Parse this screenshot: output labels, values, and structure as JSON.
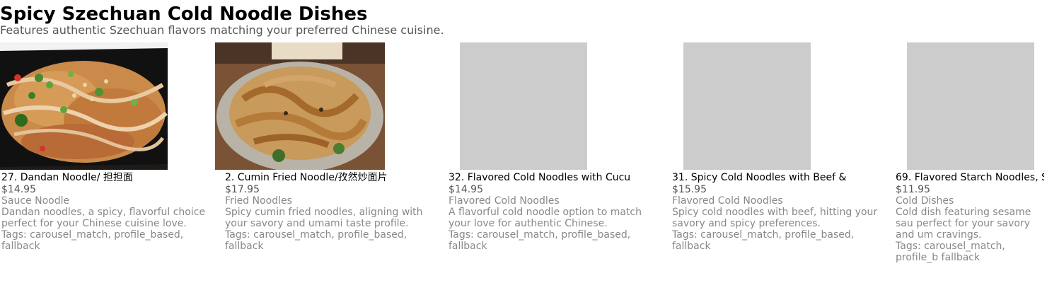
{
  "header": {
    "title": "Spicy Szechuan Cold Noodle Dishes",
    "subtitle": "Features authentic Szechuan flavors matching your preferred Chinese cuisine."
  },
  "tags_label": "Tags:",
  "items": [
    {
      "name": "27. Dandan Noodle/ 担担面",
      "price": "$14.95",
      "category": "Sauce Noodle",
      "description": "Dandan noodles, a spicy, flavorful choice perfect for your Chinese cuisine love.",
      "tags": "carousel_match, profile_based, fallback",
      "image": "photo"
    },
    {
      "name": "2. Cumin Fried Noodle/孜然炒面片",
      "price": "$17.95",
      "category": "Fried Noodles",
      "description": "Spicy cumin fried noodles, aligning with your savory and umami taste profile.",
      "tags": "carousel_match, profile_based, fallback",
      "image": "photo"
    },
    {
      "name": "32. Flavored Cold Noodles with Cucu",
      "price": "$14.95",
      "category": "Flavored Cold Noodles",
      "description": "A flavorful cold noodle option to match your love for authentic Chinese.",
      "tags": "carousel_match, profile_based, fallback",
      "image": "placeholder"
    },
    {
      "name": "31. Spicy Cold Noodles with Beef &",
      "price": "$15.95",
      "category": "Flavored Cold Noodles",
      "description": "Spicy cold noodles with beef, hitting your savory and spicy preferences.",
      "tags": "carousel_match, profile_based, fallback",
      "image": "placeholder"
    },
    {
      "name": "69. Flavored Starch Noodles, S",
      "price": "$11.95",
      "category": "Cold Dishes",
      "description": "Cold dish featuring sesame sau perfect for your savory and um cravings.",
      "tags": "carousel_match, profile_b fallback",
      "image": "placeholder"
    }
  ]
}
